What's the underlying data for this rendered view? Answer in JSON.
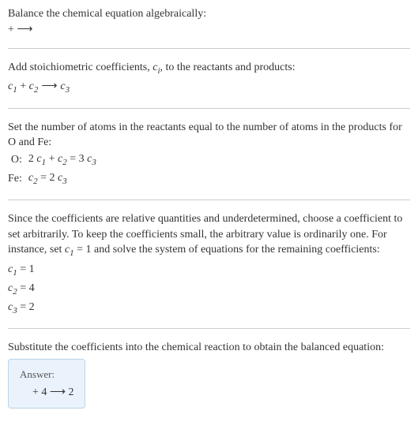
{
  "intro": {
    "line1": "Balance the chemical equation algebraically:",
    "reaction": " +  ⟶ "
  },
  "step1": {
    "text": "Add stoichiometric coefficients, c_i, to the reactants and products:",
    "reaction_prefix1": "c",
    "reaction_sub1": "1",
    "reaction_plus": " + ",
    "reaction_prefix2": "c",
    "reaction_sub2": "2",
    "reaction_arrow": " ⟶ ",
    "reaction_prefix3": "c",
    "reaction_sub3": "3"
  },
  "step2": {
    "text": "Set the number of atoms in the reactants equal to the number of atoms in the products for O and Fe:",
    "rows": [
      {
        "label": "O:",
        "eq": "2 c₁ + c₂ = 3 c₃"
      },
      {
        "label": "Fe:",
        "eq": "c₂ = 2 c₃"
      }
    ]
  },
  "step3": {
    "text": "Since the coefficients are relative quantities and underdetermined, choose a coefficient to set arbitrarily. To keep the coefficients small, the arbitrary value is ordinarily one. For instance, set c₁ = 1 and solve the system of equations for the remaining coefficients:",
    "results": [
      "c₁ = 1",
      "c₂ = 4",
      "c₃ = 2"
    ]
  },
  "step4": {
    "text": "Substitute the coefficients into the chemical reaction to obtain the balanced equation:"
  },
  "answer": {
    "label": "Answer:",
    "equation": " + 4  ⟶ 2 "
  }
}
